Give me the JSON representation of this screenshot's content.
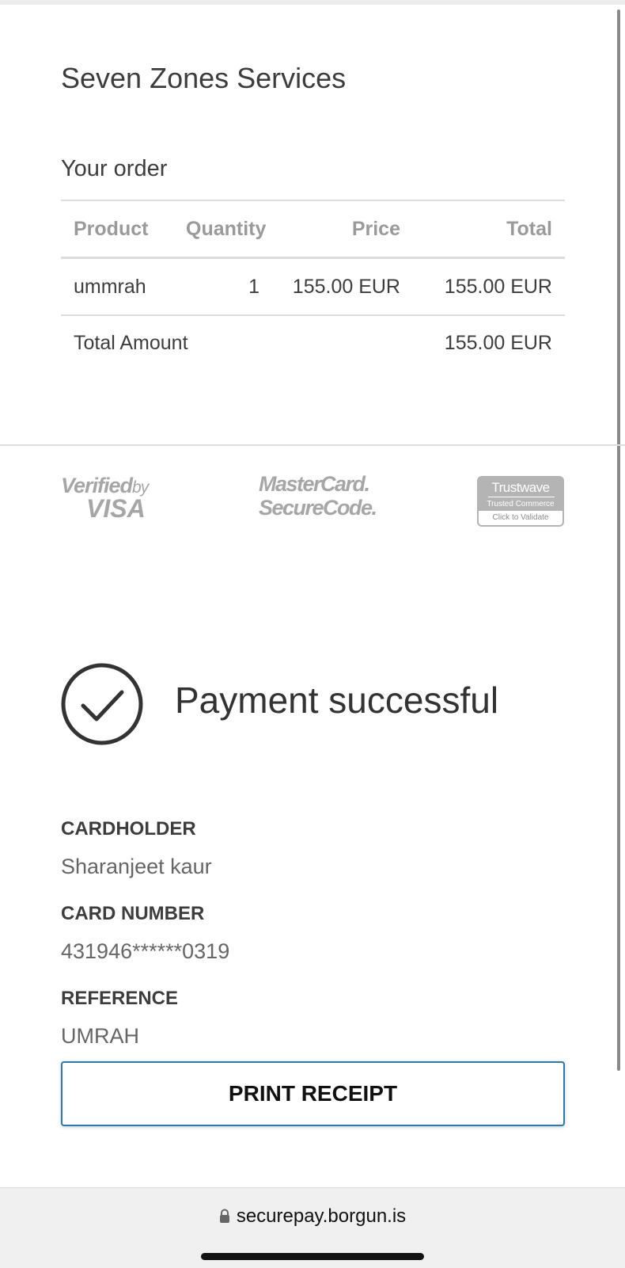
{
  "merchant": {
    "name": "Seven Zones Services"
  },
  "order": {
    "heading": "Your order",
    "columns": [
      "Product",
      "Quantity",
      "Price",
      "Total"
    ],
    "rows": [
      {
        "product": "ummrah",
        "quantity": "1",
        "price": "155.00 EUR",
        "total": "155.00 EUR"
      }
    ],
    "total_label": "Total Amount",
    "total_value": "155.00 EUR"
  },
  "security_badges": {
    "verified_by_visa": {
      "line1": "Verified",
      "line1_small": "by",
      "line2": "VISA"
    },
    "mastercard_securecode": {
      "line1": "MasterCard.",
      "line2": "SecureCode."
    },
    "trustwave": {
      "title": "Trustwave",
      "subtitle": "Trusted Commerce",
      "link": "Click to Validate"
    }
  },
  "status": {
    "icon": "checkmark-circle-icon",
    "message": "Payment successful"
  },
  "details": {
    "cardholder_label": "CARDHOLDER",
    "cardholder_value": "Sharanjeet kaur",
    "card_number_label": "CARD NUMBER",
    "card_number_value": "431946******0319",
    "reference_label": "REFERENCE",
    "reference_value": "UMRAH"
  },
  "actions": {
    "print_label": "PRINT RECEIPT"
  },
  "browser": {
    "url": "securepay.borgun.is",
    "icon": "lock-icon"
  },
  "colors": {
    "accent": "#2f78a8",
    "text": "#333333",
    "muted": "#9a9a9a",
    "badge_gray": "#a6a6a6"
  }
}
